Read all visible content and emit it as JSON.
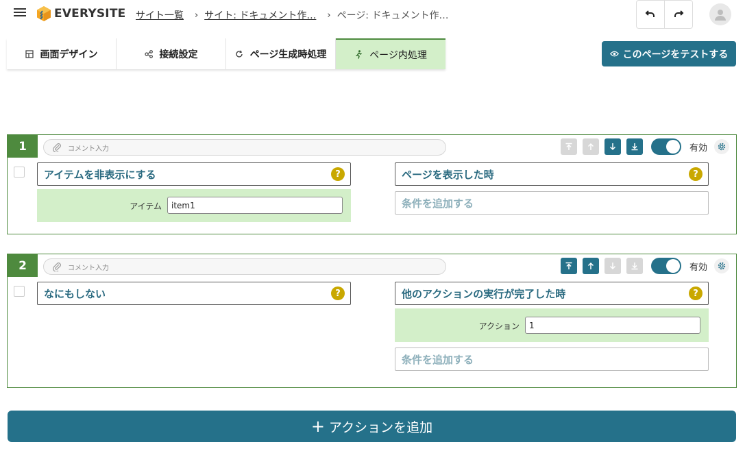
{
  "header": {
    "logo_text": "EVERYSITE",
    "breadcrumbs": [
      {
        "label": "サイト一覧"
      },
      {
        "label": "サイト: ドキュメント作…"
      },
      {
        "label": "ページ: ドキュメント作…"
      }
    ]
  },
  "tabs": [
    {
      "label": "画面デザイン",
      "icon": "layout-icon"
    },
    {
      "label": "接続設定",
      "icon": "nodes-icon"
    },
    {
      "label": "ページ生成時処理",
      "icon": "refresh-icon"
    },
    {
      "label": "ページ内処理",
      "icon": "running-icon",
      "active": true
    }
  ],
  "test_button": {
    "label": "このページをテストする"
  },
  "colors": {
    "accent": "#25718a",
    "green": "#4e8a3e",
    "light_green": "#d3efc9",
    "help": "#c9a800"
  },
  "actions": [
    {
      "number": "1",
      "comment_placeholder": "コメント入力",
      "enabled_label": "有効",
      "action_label": "アイテムを非表示にする",
      "param_label": "アイテム",
      "param_value": "item1",
      "trigger_label": "ページを表示した時",
      "add_condition": "条件を追加する"
    },
    {
      "number": "2",
      "comment_placeholder": "コメント入力",
      "enabled_label": "有効",
      "action_label": "なにもしない",
      "trigger_label": "他のアクションの実行が完了した時",
      "trigger_param_label": "アクション",
      "trigger_param_value": "1",
      "add_condition": "条件を追加する"
    }
  ],
  "add_action": {
    "label": "アクションを追加"
  }
}
